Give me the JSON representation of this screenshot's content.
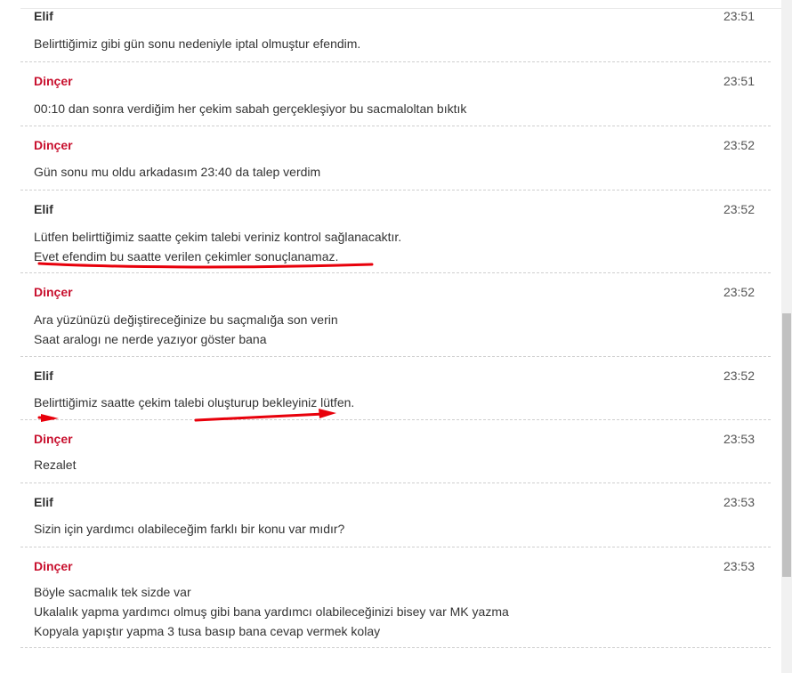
{
  "chat": {
    "messages": [
      {
        "sender": "Elif",
        "role": "agent",
        "time": "23:51",
        "lines": [
          "Belirttiğimiz gibi gün sonu nedeniyle iptal olmuştur efendim."
        ]
      },
      {
        "sender": "Dinçer",
        "role": "customer",
        "time": "23:51",
        "lines": [
          "00:10 dan sonra verdiğim her çekim sabah gerçekleşiyor bu sacmaloltan bıktık"
        ]
      },
      {
        "sender": "Dinçer",
        "role": "customer",
        "time": "23:52",
        "lines": [
          "Gün sonu mu oldu arkadasım 23:40 da talep verdim"
        ]
      },
      {
        "sender": "Elif",
        "role": "agent",
        "time": "23:52",
        "lines": [
          "Lütfen belirttiğimiz saatte çekim talebi veriniz kontrol sağlanacaktır.",
          "Evet efendim bu saatte verilen çekimler sonuçlanamaz."
        ]
      },
      {
        "sender": "Dinçer",
        "role": "customer",
        "time": "23:52",
        "lines": [
          "Ara yüzünüzü değiştireceğinize bu saçmalığa son verin",
          "Saat aralogı ne nerde yazıyor göster bana"
        ]
      },
      {
        "sender": "Elif",
        "role": "agent",
        "time": "23:52",
        "lines": [
          "Belirttiğimiz saatte çekim talebi oluşturup bekleyiniz lütfen."
        ]
      },
      {
        "sender": "Dinçer",
        "role": "customer",
        "time": "23:53",
        "lines": [
          "Rezalet"
        ]
      },
      {
        "sender": "Elif",
        "role": "agent",
        "time": "23:53",
        "lines": [
          "Sizin için yardımcı olabileceğim farklı bir konu var mıdır?"
        ]
      },
      {
        "sender": "Dinçer",
        "role": "customer",
        "time": "23:53",
        "lines": [
          "Böyle sacmalık tek sizde var",
          "Ukalalık yapma yardımcı olmuş gibi bana yardımcı olabileceğinizi bisey var MK yazma",
          "Kopyala yapıştır yapma 3 tusa basıp bana cevap vermek kolay"
        ]
      }
    ]
  },
  "colors": {
    "agent_name": "#333333",
    "customer_name": "#c8102e",
    "annotation_red": "#e8000b"
  }
}
